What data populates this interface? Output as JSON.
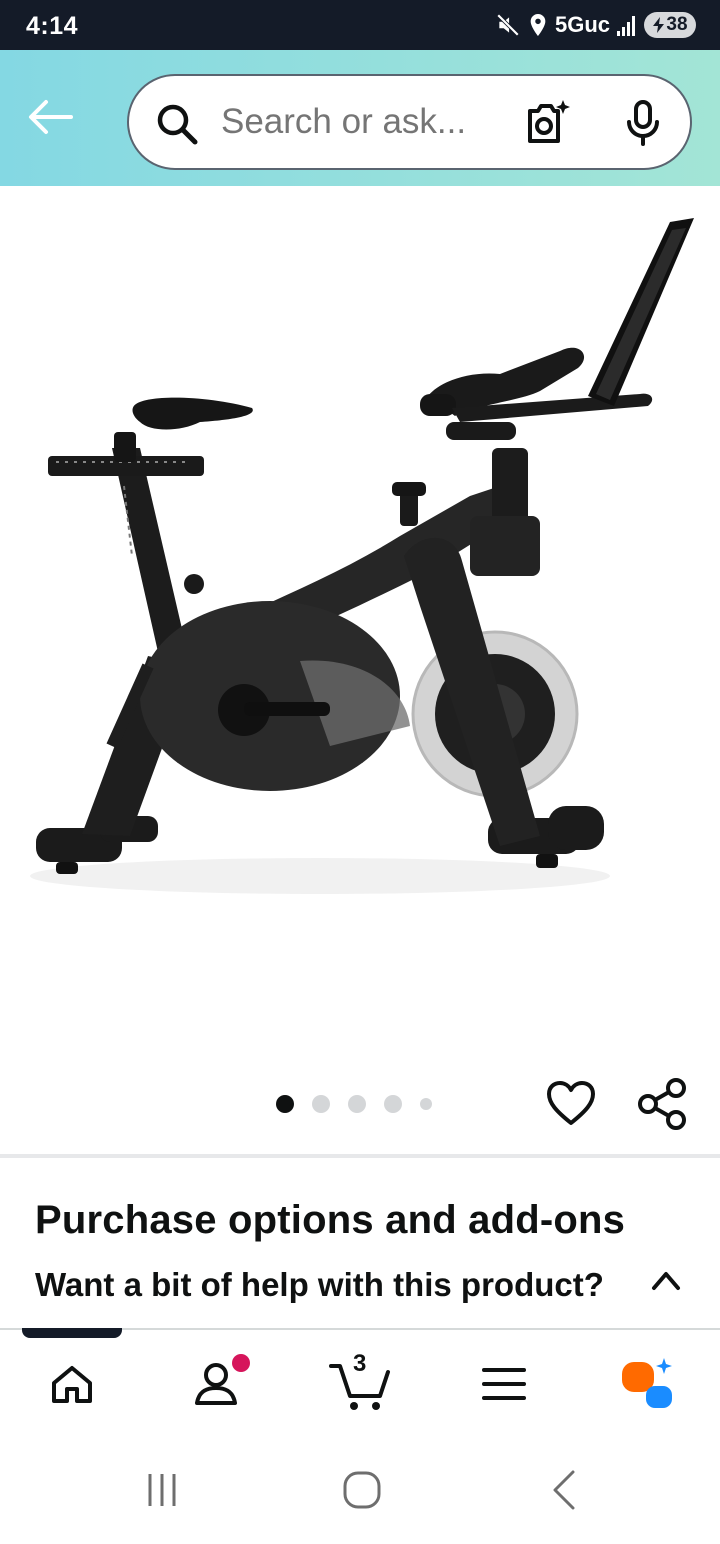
{
  "status_bar": {
    "time": "4:14",
    "network": "5Guc",
    "battery": "38"
  },
  "search": {
    "placeholder": "Search or ask..."
  },
  "carousel": {
    "total_dots": 5,
    "active_index": 0
  },
  "sections": {
    "purchase_title": "Purchase options and add-ons",
    "help_text": "Want a bit of help with this product?"
  },
  "bottom_nav": {
    "cart_count": "3",
    "items": [
      "home-icon",
      "account-icon",
      "cart-icon",
      "menu-icon",
      "rufus-ai-icon"
    ],
    "active": "home-icon"
  },
  "colors": {
    "header_gradient_start": "#84d8e3",
    "header_gradient_end": "#a3e5d6",
    "status_bar": "#141b28",
    "notification_dot": "#d6155b",
    "rufus_orange": "#ff6a00",
    "rufus_blue": "#1a8cff"
  }
}
